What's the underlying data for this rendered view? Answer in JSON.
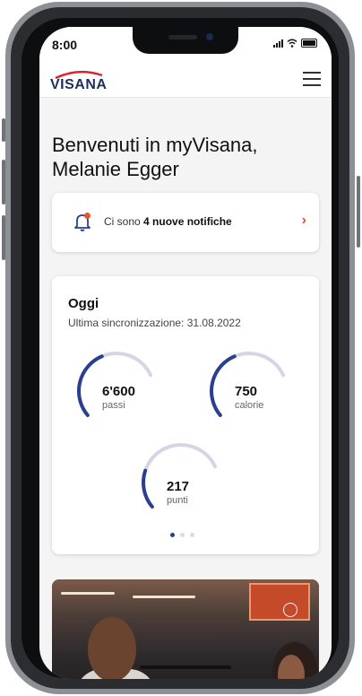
{
  "status_bar": {
    "time": "8:00"
  },
  "header": {
    "logo_text": "VISANA",
    "menu_icon": "hamburger-icon"
  },
  "greeting": {
    "line1": "Benvenuti in myVisana,",
    "line2": "Melanie Egger"
  },
  "notification": {
    "prefix": "Ci sono ",
    "highlight": "4 nuove notifiche",
    "icon": "bell-icon",
    "chevron": "›"
  },
  "today": {
    "title": "Oggi",
    "sync_label": "Ultima sincronizzazione: 31.08.2022",
    "metrics": [
      {
        "value": "6'600",
        "label": "passi",
        "progress": 0.55
      },
      {
        "value": "750",
        "label": "calorie",
        "progress": 0.55
      },
      {
        "value": "217",
        "label": "punti",
        "progress": 0.3
      }
    ],
    "page_count": 3,
    "active_page": 0
  },
  "colors": {
    "brand_navy": "#2a3f8f",
    "gauge_track": "#d4d6e6",
    "accent_orange": "#e8552a",
    "logo_red": "#d9252e"
  }
}
